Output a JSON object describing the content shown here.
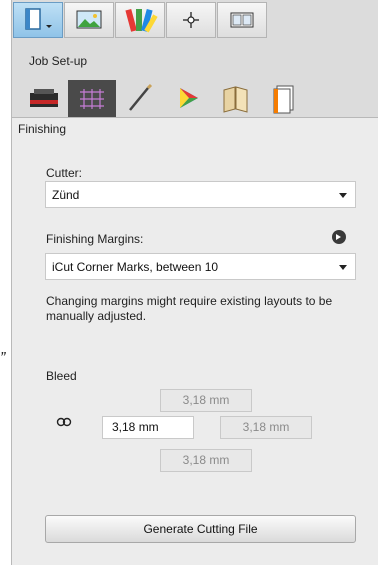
{
  "toolbar": {
    "buttons": [
      {
        "icon": "document-dropdown-icon"
      },
      {
        "icon": "image-placement-icon"
      },
      {
        "icon": "color-swatches-icon"
      },
      {
        "icon": "crosshair-icon"
      },
      {
        "icon": "layout-icon"
      }
    ]
  },
  "job_setup": {
    "title": "Job Set-up",
    "tabs": [
      {
        "icon": "printer-icon"
      },
      {
        "icon": "grid-icon"
      },
      {
        "icon": "brush-icon"
      },
      {
        "icon": "color-profile-icon"
      },
      {
        "icon": "book-icon"
      },
      {
        "icon": "page-layout-icon"
      }
    ]
  },
  "finishing": {
    "title": "Finishing",
    "cutter_label": "Cutter:",
    "cutter_value": "Zünd",
    "margins_label": "Finishing Margins:",
    "margins_value": "iCut Corner Marks, between 10",
    "note": "Changing margins might require existing layouts to be manually adjusted.",
    "side_marker": "”",
    "bleed_label": "Bleed",
    "bleed": {
      "top": "3,18 mm",
      "left": "3,18 mm",
      "right": "3,18 mm",
      "bottom": "3,18 mm"
    },
    "generate_button": "Generate Cutting File"
  }
}
